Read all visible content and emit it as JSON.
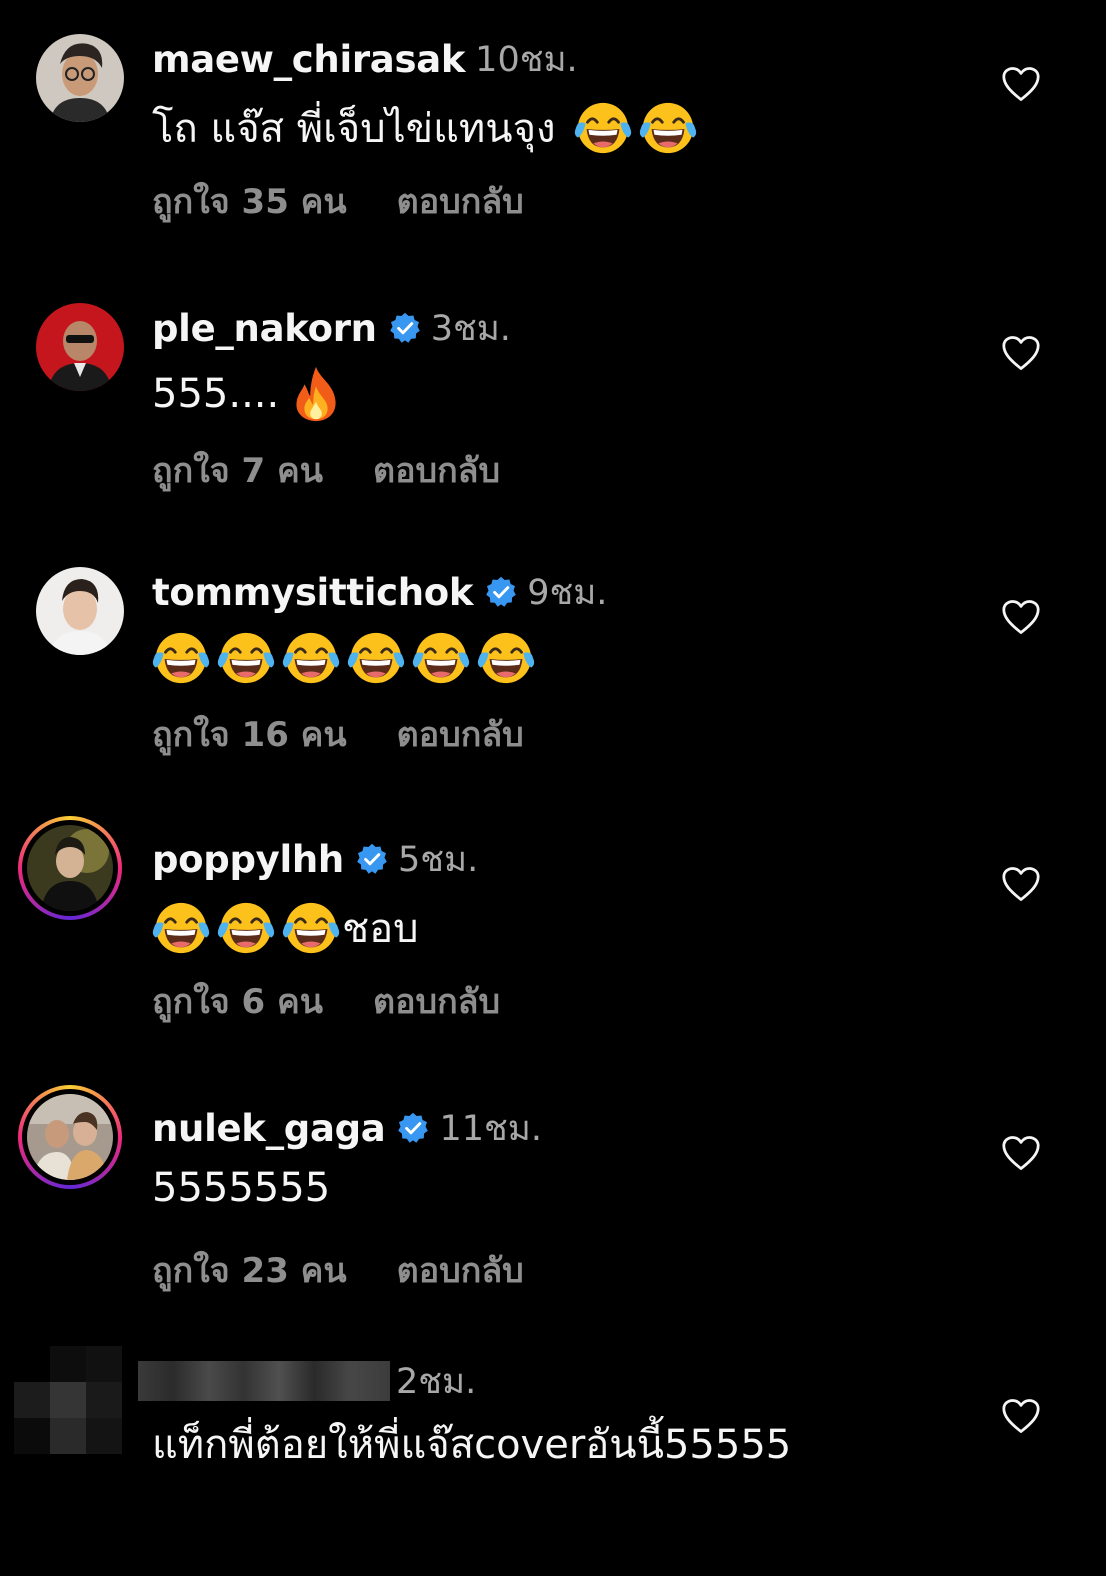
{
  "comments": [
    {
      "username": "maew_chirasak",
      "verified": false,
      "time": "10ชม.",
      "text": "โถ แจ๊ส พี่เจ็บไข่แทนจุง",
      "emoji_count": 2,
      "likes": "ถูกใจ 35 คน",
      "reply": "ตอบกลับ",
      "avatar_style": "plain"
    },
    {
      "username": "ple_nakorn",
      "verified": true,
      "time": "3ชม.",
      "text": "555....",
      "emoji": "fire-emoji",
      "likes": "ถูกใจ 7 คน",
      "reply": "ตอบกลับ",
      "avatar_style": "plain"
    },
    {
      "username": "tommysittichok",
      "verified": true,
      "time": "9ชม.",
      "text": "",
      "emoji_count": 6,
      "likes": "ถูกใจ 16 คน",
      "reply": "ตอบกลับ",
      "avatar_style": "plain"
    },
    {
      "username": "poppylhh",
      "verified": true,
      "time": "5ชม.",
      "text": "ชอบ",
      "emoji_count": 3,
      "likes": "ถูกใจ 6 คน",
      "reply": "ตอบกลับ",
      "avatar_style": "story-ring"
    },
    {
      "username": "nulek_gaga",
      "verified": true,
      "time": "11ชม.",
      "text": "5555555",
      "likes": "ถูกใจ 23 คน",
      "reply": "ตอบกลับ",
      "avatar_style": "story-ring"
    },
    {
      "username": "",
      "verified": false,
      "time": "2ชม.",
      "text": "แท็กพี่ต้อยให้พี่แจ๊สcoverอันนี้55555",
      "avatar_style": "pixelated"
    }
  ],
  "icons": {
    "heart": "heart-outline-icon",
    "verified": "verified-badge-icon",
    "laugh": "face-with-tears-of-joy-emoji",
    "fire": "fire-emoji"
  },
  "colors": {
    "background": "#000000",
    "primary_text": "#f5f5f5",
    "secondary_text": "#a8a8a8",
    "meta_text": "#8e8e8e",
    "verified_blue": "#3897f0"
  }
}
